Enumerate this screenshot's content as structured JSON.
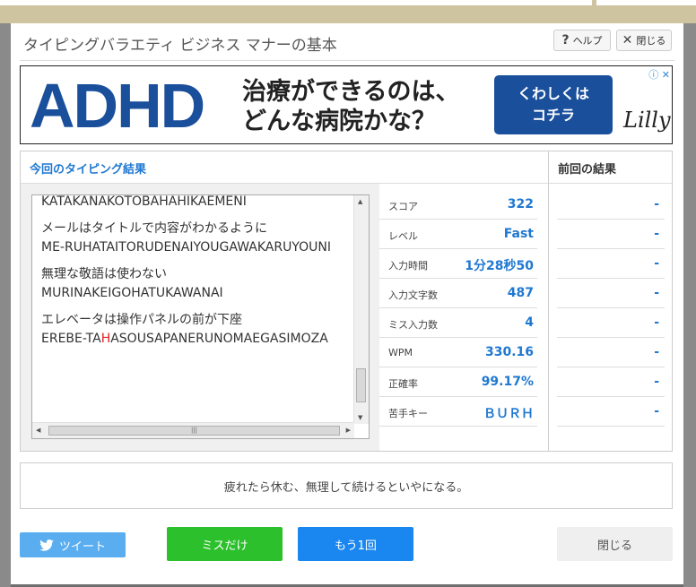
{
  "modal": {
    "title": "タイピングバラエティ ビジネス マナーの基本",
    "help_label": "ヘルプ",
    "close_label": "閉じる"
  },
  "ad": {
    "logo_text": "ADHD",
    "line1": "治療ができるのは、",
    "line2": "どんな病院かな？",
    "button_line1": "くわしくは",
    "button_line2": "コチラ",
    "brand": "Lilly",
    "info_icon": "info-icon",
    "close_icon": "close-icon"
  },
  "results": {
    "current_header": "今回のタイピング結果",
    "previous_header": "前回の結果",
    "log": [
      {
        "jp": "",
        "roman": "KATAKANAKOTOBAHAHIKAEMENI"
      },
      {
        "jp": "メールはタイトルで内容がわかるように",
        "roman": "ME-RUHATAITORUDENAIYOUGAWAKARUYOUNI"
      },
      {
        "jp": "無理な敬語は使わない",
        "roman": "MURINAKEIGOHATUKAWANAI"
      },
      {
        "jp": "エレベータは操作パネルの前が下座",
        "roman_pre": "EREBE-TA",
        "roman_miss": "H",
        "roman_post": "ASOUSAPANERUNOMAEGASIMOZA"
      }
    ],
    "stats": [
      {
        "label": "スコア",
        "value": "322",
        "previous": "-"
      },
      {
        "label": "レベル",
        "value": "Fast",
        "previous": "-"
      },
      {
        "label": "入力時間",
        "value": "1分28秒50",
        "previous": "-"
      },
      {
        "label": "入力文字数",
        "value": "487",
        "previous": "-"
      },
      {
        "label": "ミス入力数",
        "value": "4",
        "previous": "-"
      },
      {
        "label": "WPM",
        "value": "330.16",
        "previous": "-"
      },
      {
        "label": "正確率",
        "value": "99.17%",
        "previous": "-"
      },
      {
        "label": "苦手キー",
        "value": "ＢＵＲＨ",
        "previous": "-"
      }
    ]
  },
  "message": "疲れたら休む、無理して続けるといやになる。",
  "buttons": {
    "tweet": "ツイート",
    "miss_only": "ミスだけ",
    "again": "もう1回",
    "close": "閉じる"
  },
  "colors": {
    "accent_blue": "#1f78d1",
    "miss_red": "#e02020",
    "green": "#2dc02d",
    "tweet_blue": "#5aaef0"
  }
}
